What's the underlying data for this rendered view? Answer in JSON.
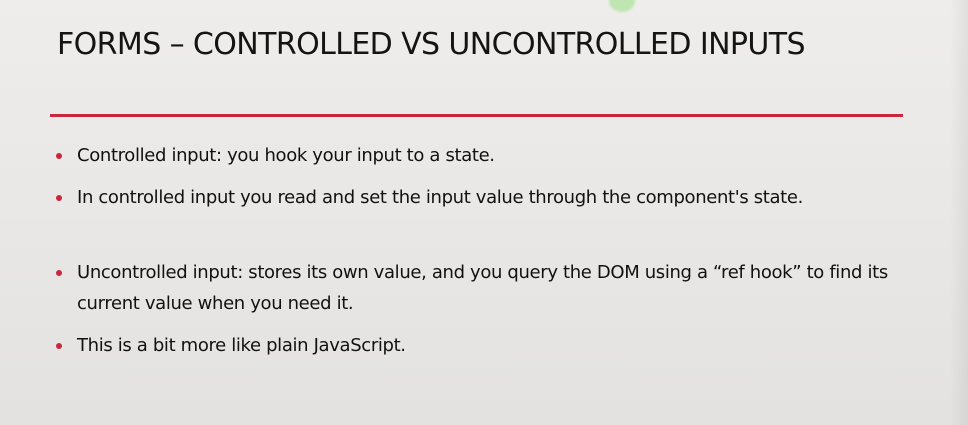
{
  "slide": {
    "title": "FORMS – CONTROLLED VS UNCONTROLLED INPUTS",
    "accent_color": "#c7283e",
    "bullets": [
      {
        "text": "Controlled input: you hook your input to a state."
      },
      {
        "text": "In controlled input you read and set the input value through the component's state."
      },
      {
        "text": "Uncontrolled input: stores its own value, and you query the DOM using a “ref hook” to find its current value when you need it."
      },
      {
        "text": "This is a bit more like plain JavaScript."
      }
    ]
  }
}
